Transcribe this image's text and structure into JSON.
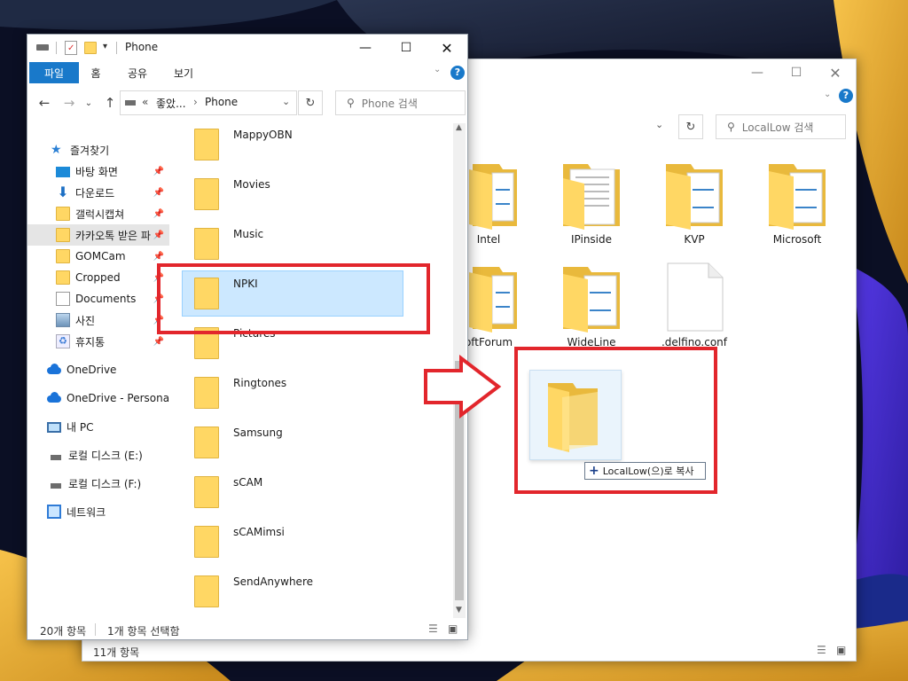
{
  "colors": {
    "accent": "#1979ca",
    "selection": "#cce8ff",
    "highlight_red": "#e2262c",
    "folder": "#ffd764"
  },
  "front_window": {
    "title": "Phone",
    "ribbon_tabs": [
      "파일",
      "홈",
      "공유",
      "보기"
    ],
    "breadcrumb": {
      "prefix": "«",
      "part1": "좋았...",
      "separator": "›",
      "part2": "Phone"
    },
    "search_placeholder": "Phone 검색",
    "nav_items": [
      {
        "label": "즐겨찾기",
        "icon": "star-icon",
        "pinned": false
      },
      {
        "label": "바탕 화면",
        "icon": "desktop-icon",
        "pinned": true
      },
      {
        "label": "다운로드",
        "icon": "download-icon",
        "pinned": true
      },
      {
        "label": "갤럭시캡쳐",
        "icon": "folder-icon",
        "pinned": true
      },
      {
        "label": "카카오톡 받은 파",
        "icon": "folder-icon",
        "pinned": true
      },
      {
        "label": "GOMCam",
        "icon": "folder-icon",
        "pinned": true
      },
      {
        "label": "Cropped",
        "icon": "folder-icon",
        "pinned": true
      },
      {
        "label": "Documents",
        "icon": "documents-icon",
        "pinned": true
      },
      {
        "label": "사진",
        "icon": "pictures-icon",
        "pinned": true
      },
      {
        "label": "휴지통",
        "icon": "recycle-bin-icon",
        "pinned": true
      },
      {
        "label": "OneDrive",
        "icon": "onedrive-icon",
        "pinned": false
      },
      {
        "label": "OneDrive - Personal",
        "icon": "onedrive-icon",
        "pinned": false
      },
      {
        "label": "내 PC",
        "icon": "pc-icon",
        "pinned": false
      },
      {
        "label": "로컬 디스크 (E:)",
        "icon": "drive-icon",
        "pinned": false
      },
      {
        "label": "로컬 디스크 (F:)",
        "icon": "drive-icon",
        "pinned": false
      },
      {
        "label": "네트워크",
        "icon": "network-icon",
        "pinned": false
      }
    ],
    "files": [
      "MappyOBN",
      "Movies",
      "Music",
      "NPKI",
      "Pictures",
      "Ringtones",
      "Samsung",
      "sCAM",
      "sCAMimsi",
      "SendAnywhere"
    ],
    "selected_file": "NPKI",
    "status_count": "20개 항목",
    "status_selected": "1개 항목 선택함"
  },
  "back_window": {
    "search_placeholder": "LocalLow 검색",
    "items": [
      {
        "name": "Intel",
        "type": "folder"
      },
      {
        "name": "IPinside",
        "type": "folder"
      },
      {
        "name": "KVP",
        "type": "folder"
      },
      {
        "name": "Microsoft",
        "type": "folder"
      },
      {
        "name": "oftForum",
        "type": "folder"
      },
      {
        "name": "WideLine",
        "type": "folder"
      },
      {
        "name": ".delfino.conf",
        "type": "file"
      }
    ],
    "status_count": "11개 항목"
  },
  "drag_tooltip": {
    "plus": "+",
    "text": "LocalLow(으)로 복사"
  }
}
